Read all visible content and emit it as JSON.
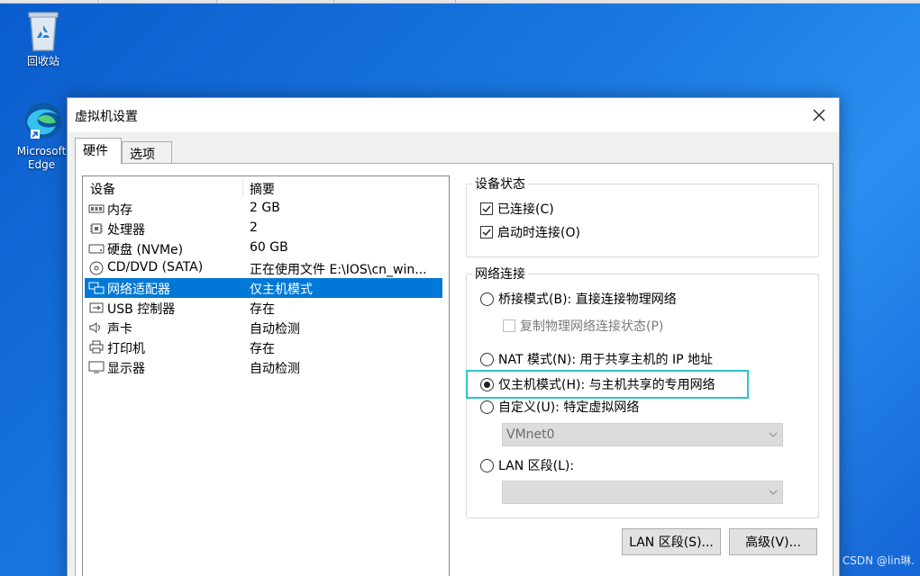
{
  "desktop": {
    "recycle_bin_label": "回收站",
    "edge_label_line1": "Microsoft",
    "edge_label_line2": "Edge"
  },
  "dialog": {
    "title": "虚拟机设置",
    "tabs": [
      {
        "label": "硬件",
        "active": true
      },
      {
        "label": "选项",
        "active": false
      }
    ],
    "device_list": {
      "col_device": "设备",
      "col_summary": "摘要",
      "rows": [
        {
          "icon": "memory-icon",
          "name": "内存",
          "summary": "2 GB",
          "selected": false
        },
        {
          "icon": "processor-icon",
          "name": "处理器",
          "summary": "2",
          "selected": false
        },
        {
          "icon": "hard-disk-icon",
          "name": "硬盘 (NVMe)",
          "summary": "60 GB",
          "selected": false
        },
        {
          "icon": "cd-dvd-icon",
          "name": "CD/DVD (SATA)",
          "summary": "正在使用文件 E:\\IOS\\cn_win...",
          "selected": false
        },
        {
          "icon": "network-adapter-icon",
          "name": "网络适配器",
          "summary": "仅主机模式",
          "selected": true
        },
        {
          "icon": "usb-icon",
          "name": "USB 控制器",
          "summary": "存在",
          "selected": false
        },
        {
          "icon": "sound-card-icon",
          "name": "声卡",
          "summary": "自动检测",
          "selected": false
        },
        {
          "icon": "printer-icon",
          "name": "打印机",
          "summary": "存在",
          "selected": false
        },
        {
          "icon": "display-icon",
          "name": "显示器",
          "summary": "自动检测",
          "selected": false
        }
      ]
    },
    "device_status": {
      "legend": "设备状态",
      "connected_label": "已连接(C)",
      "connected_checked": true,
      "connect_on_start_label": "启动时连接(O)",
      "connect_on_start_checked": true
    },
    "network": {
      "legend": "网络连接",
      "bridged_label": "桥接模式(B): 直接连接物理网络",
      "replicate_label": "复制物理网络连接状态(P)",
      "nat_label": "NAT 模式(N): 用于共享主机的 IP 地址",
      "host_only_label": "仅主机模式(H): 与主机共享的专用网络",
      "custom_label": "自定义(U): 特定虚拟网络",
      "custom_value": "VMnet0",
      "lan_label": "LAN 区段(L):",
      "lan_value": "",
      "selected": "host_only"
    },
    "buttons": {
      "lan_segments": "LAN 区段(S)...",
      "advanced": "高级(V)..."
    }
  },
  "watermark": "CSDN @lin琳.",
  "colors": {
    "selection": "#0078d7",
    "highlight_box": "#2ec5c8",
    "desktop": "#1a78e0"
  }
}
